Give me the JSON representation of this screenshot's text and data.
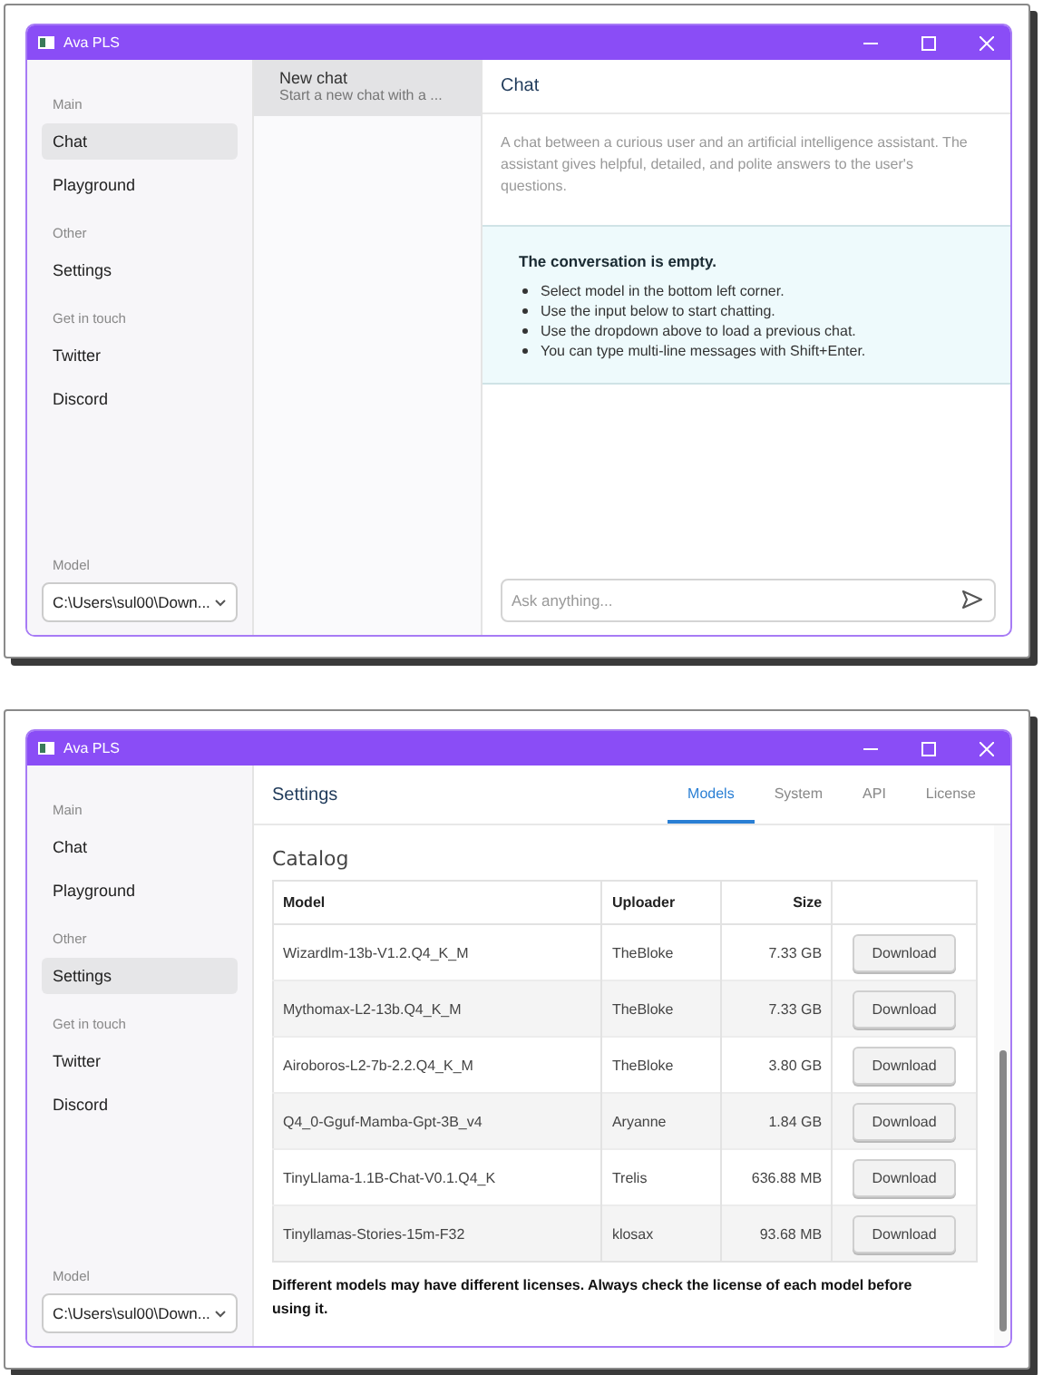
{
  "windows": [
    {
      "title": "Ava PLS",
      "kind": "chat",
      "sidebar": {
        "sections": [
          {
            "heading": "Main",
            "items": [
              {
                "label": "Chat",
                "selected": true
              },
              {
                "label": "Playground",
                "selected": false
              }
            ]
          },
          {
            "heading": "Other",
            "items": [
              {
                "label": "Settings",
                "selected": false
              }
            ]
          },
          {
            "heading": "Get in touch",
            "items": [
              {
                "label": "Twitter",
                "selected": false
              },
              {
                "label": "Discord",
                "selected": false
              }
            ]
          }
        ],
        "model_label": "Model",
        "model_value": "C:\\Users\\sul00\\Down..."
      },
      "chats": [
        {
          "title": "New chat",
          "subtitle": "Start a new chat with a ...",
          "selected": true
        }
      ],
      "header": "Chat",
      "description": "A chat between a curious user and an artificial intelligence assistant. The assistant gives helpful, detailed, and polite answers to the user's questions.",
      "notice": {
        "heading": "The conversation is empty.",
        "bullets": [
          "Select model in the bottom left corner.",
          "Use the input below to start chatting.",
          "Use the dropdown above to load a previous chat.",
          "You can type multi-line messages with Shift+Enter."
        ]
      },
      "input": {
        "placeholder": "Ask anything..."
      }
    },
    {
      "title": "Ava PLS",
      "kind": "settings",
      "sidebar": {
        "sections": [
          {
            "heading": "Main",
            "items": [
              {
                "label": "Chat",
                "selected": false
              },
              {
                "label": "Playground",
                "selected": false
              }
            ]
          },
          {
            "heading": "Other",
            "items": [
              {
                "label": "Settings",
                "selected": true
              }
            ]
          },
          {
            "heading": "Get in touch",
            "items": [
              {
                "label": "Twitter",
                "selected": false
              },
              {
                "label": "Discord",
                "selected": false
              }
            ]
          }
        ],
        "model_label": "Model",
        "model_value": "C:\\Users\\sul00\\Down..."
      },
      "header": "Settings",
      "tabs": [
        {
          "label": "Models",
          "selected": true
        },
        {
          "label": "System",
          "selected": false
        },
        {
          "label": "API",
          "selected": false
        },
        {
          "label": "License",
          "selected": false
        }
      ],
      "section_title": "Catalog",
      "table": {
        "columns": [
          "Model",
          "Uploader",
          "Size"
        ],
        "rows": [
          {
            "model": "Wizardlm-13b-V1.2.Q4_K_M",
            "uploader": "TheBloke",
            "size": "7.33 GB",
            "action": "Download"
          },
          {
            "model": "Mythomax-L2-13b.Q4_K_M",
            "uploader": "TheBloke",
            "size": "7.33 GB",
            "action": "Download"
          },
          {
            "model": "Airoboros-L2-7b-2.2.Q4_K_M",
            "uploader": "TheBloke",
            "size": "3.80 GB",
            "action": "Download"
          },
          {
            "model": "Q4_0-Gguf-Mamba-Gpt-3B_v4",
            "uploader": "Aryanne",
            "size": "1.84 GB",
            "action": "Download"
          },
          {
            "model": "TinyLlama-1.1B-Chat-V0.1.Q4_K",
            "uploader": "Trelis",
            "size": "636.88 MB",
            "action": "Download"
          },
          {
            "model": "Tinyllamas-Stories-15m-F32",
            "uploader": "klosax",
            "size": "93.68 MB",
            "action": "Download"
          }
        ]
      },
      "footnote": "Different models may have different licenses. Always check the license of each model before using it."
    }
  ]
}
